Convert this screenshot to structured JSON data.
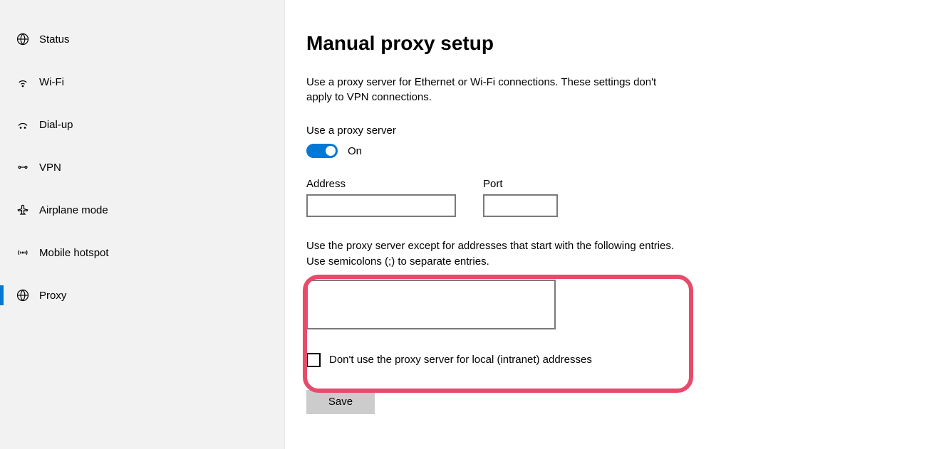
{
  "sidebar": {
    "items": [
      {
        "label": "Status"
      },
      {
        "label": "Wi-Fi"
      },
      {
        "label": "Dial-up"
      },
      {
        "label": "VPN"
      },
      {
        "label": "Airplane mode"
      },
      {
        "label": "Mobile hotspot"
      },
      {
        "label": "Proxy"
      }
    ]
  },
  "main": {
    "title": "Manual proxy setup",
    "description": "Use a proxy server for Ethernet or Wi-Fi connections. These settings don't apply to VPN connections.",
    "use_proxy_label": "Use a proxy server",
    "toggle_state": "On",
    "address_label": "Address",
    "address_value": "",
    "port_label": "Port",
    "port_value": "",
    "exceptions_label": "Use the proxy server except for addresses that start with the following entries. Use semicolons (;) to separate entries.",
    "exceptions_value": "",
    "checkbox_label": "Don't use the proxy server for local (intranet) addresses",
    "checkbox_checked": false,
    "save_label": "Save"
  }
}
